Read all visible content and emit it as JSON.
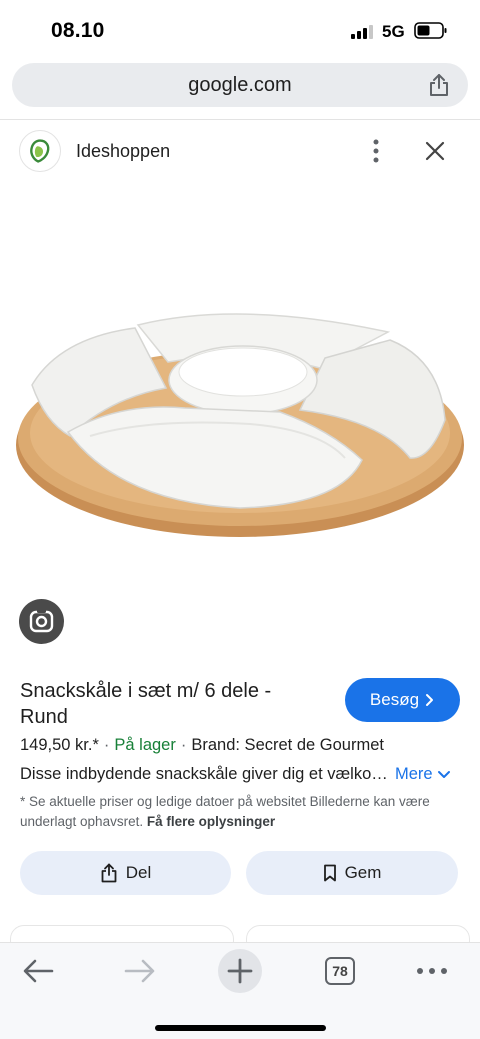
{
  "status_bar": {
    "time": "08.10",
    "network": "5G",
    "signal_bars_active": 3,
    "signal_bars_total": 4
  },
  "browser": {
    "url": "google.com",
    "tab_count": "78"
  },
  "source": {
    "name": "Ideshoppen"
  },
  "product": {
    "title": "Snackskåle i sæt m/ 6 dele - Rund",
    "visit_label": "Besøg",
    "price": "149,50 kr.*",
    "stock": "På lager",
    "brand": "Brand: Secret de Gourmet",
    "description": "Disse indbydende snackskåle giver dig et vælkomment",
    "more_label": "Mere",
    "disclaimer": "* Se aktuelle priser og ledige datoer på websitet Billederne kan være underlagt ophavsret.",
    "disclaimer_link": "Få flere oplysninger"
  },
  "actions": {
    "share_label": "Del",
    "save_label": "Gem"
  },
  "colors": {
    "accent_blue": "#1a73e8",
    "in_stock_green": "#188038",
    "action_bg": "#e8eef9",
    "wood": "#d9a56a"
  },
  "icons": {
    "favicon": "ideshoppen-logo-icon",
    "lens": "google-lens-icon"
  }
}
